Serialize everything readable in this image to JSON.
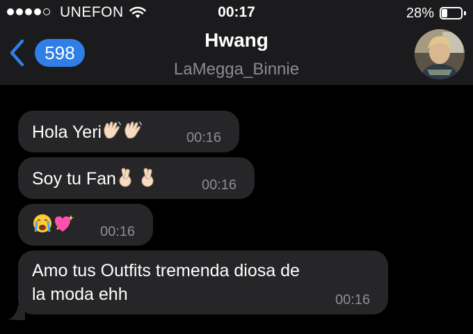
{
  "status_bar": {
    "carrier": "UNEFON",
    "time": "00:17",
    "battery_percent": "28%",
    "battery_level": 0.28,
    "signal_bars": 4,
    "signal_max": 5,
    "wifi_icon": "wifi-icon"
  },
  "header": {
    "back_icon": "chevron-left-icon",
    "unread_count": "598",
    "title": "Hwang",
    "subtitle": "LaMegga_Binnie",
    "accent_color": "#2f7fe6"
  },
  "messages": [
    {
      "text": "Hola Yeri",
      "emoji": [
        "waving-hand",
        "waving-hand"
      ],
      "time": "00:16"
    },
    {
      "text": "Soy tu Fan",
      "emoji": [
        "crossed-fingers",
        "crossed-fingers"
      ],
      "time": "00:16"
    },
    {
      "text": "",
      "emoji": [
        "crying-face",
        "sparkling-heart"
      ],
      "time": "00:16"
    },
    {
      "text": "Amo tus Outfits tremenda diosa de",
      "text_line2": "la moda ehh",
      "time": "00:16"
    }
  ]
}
